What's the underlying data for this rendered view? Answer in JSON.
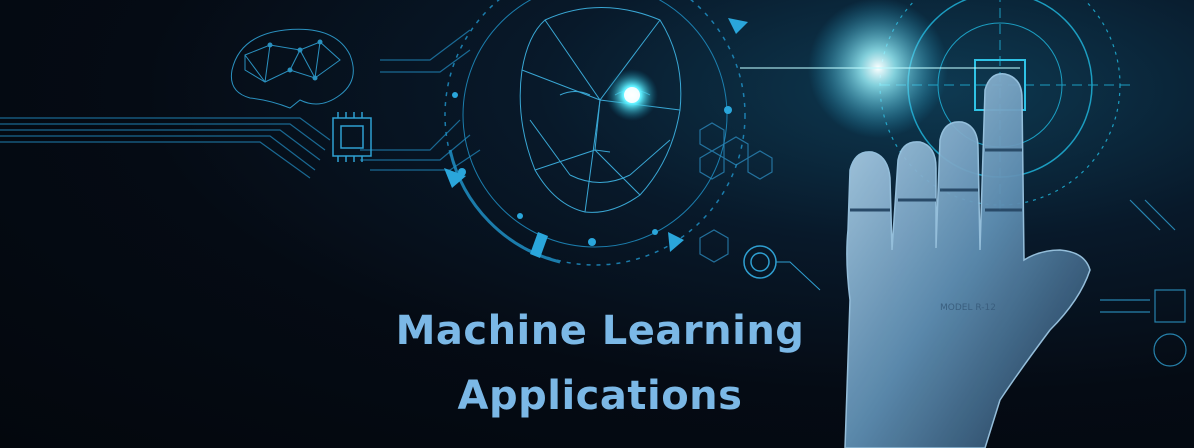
{
  "banner": {
    "title_line_1": "Machine Learning",
    "title_line_2": "Applications",
    "hand_engraving": "MODEL R-12",
    "colors": {
      "background": "#050b14",
      "title": "#7bb8e6",
      "circuit": "#2f9fd1",
      "glow": "#7ef3ff"
    }
  }
}
